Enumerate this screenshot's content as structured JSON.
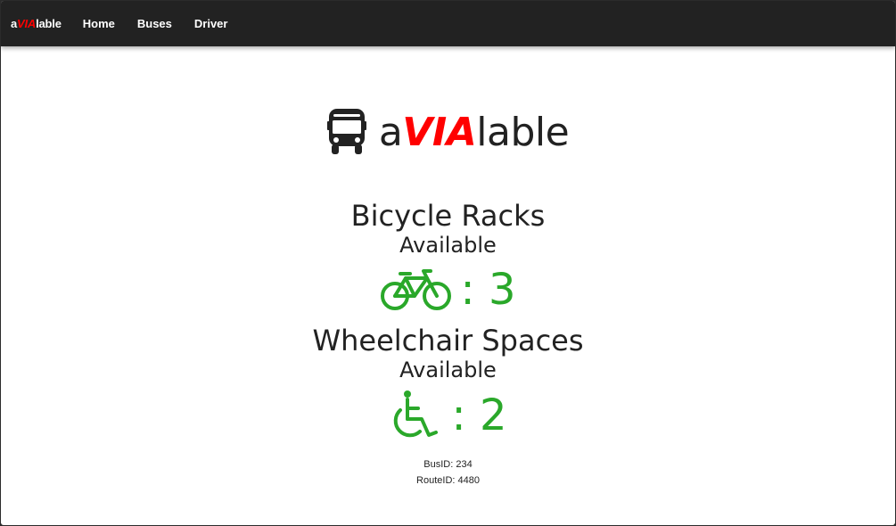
{
  "navbar": {
    "brand": {
      "prefix": "a",
      "highlight": "VIA",
      "suffix": "lable"
    },
    "links": [
      "Home",
      "Buses",
      "Driver"
    ]
  },
  "logo": {
    "icon": "bus-icon",
    "prefix": "a",
    "highlight": "VIA",
    "suffix": "lable"
  },
  "bicycle": {
    "title": "Bicycle Racks",
    "subtitle": "Available",
    "icon": "bicycle-icon",
    "count_text": ": 3"
  },
  "wheelchair": {
    "title": "Wheelchair Spaces",
    "subtitle": "Available",
    "icon": "wheelchair-icon",
    "count_text": ": 2"
  },
  "info": {
    "bus_id": "BusID: 234",
    "route_id": "RouteID: 4480"
  },
  "colors": {
    "navbar_bg": "#222222",
    "accent_red": "#ff0000",
    "available_green": "#2aa82a"
  }
}
